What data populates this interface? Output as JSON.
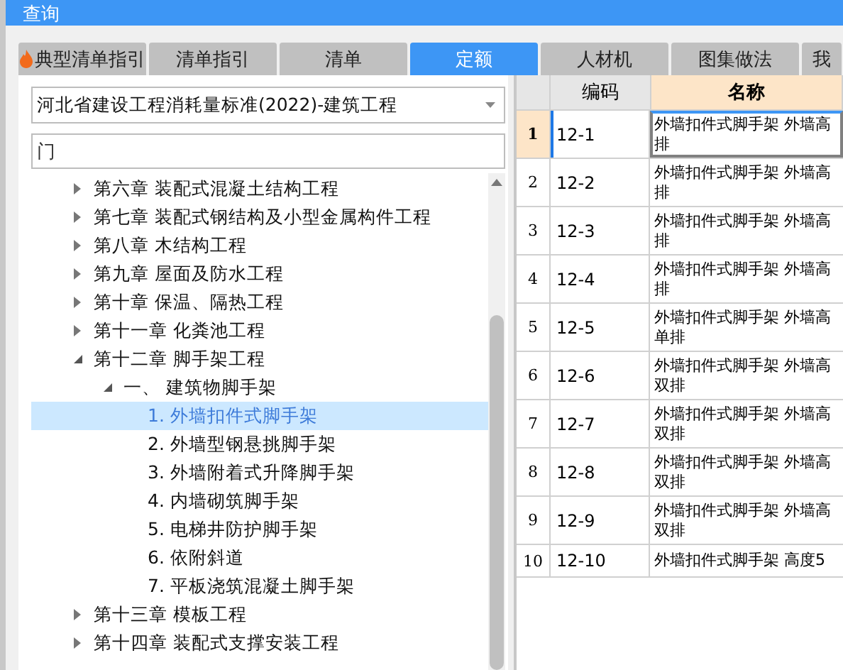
{
  "window": {
    "title": "查询"
  },
  "tabs": [
    {
      "label": "典型清单指引",
      "selected": false,
      "kind": "hot"
    },
    {
      "label": "清单指引",
      "selected": false,
      "kind": "plain"
    },
    {
      "label": "清单",
      "selected": false,
      "kind": "plain"
    },
    {
      "label": "定额",
      "selected": true,
      "kind": "plain"
    },
    {
      "label": "人材机",
      "selected": false,
      "kind": "plain"
    },
    {
      "label": "图集做法",
      "selected": false,
      "kind": "plain"
    },
    {
      "label": "我",
      "selected": false,
      "kind": "plain"
    }
  ],
  "library_select": {
    "value": "河北省建设工程消耗量标准(2022)-建筑工程"
  },
  "search": {
    "value": "门"
  },
  "tree": [
    {
      "label": "第六章 装配式混凝土结构工程",
      "expanded": false,
      "selected": false
    },
    {
      "label": "第七章 装配式钢结构及小型金属构件工程",
      "expanded": false,
      "selected": false
    },
    {
      "label": "第八章 木结构工程",
      "expanded": false,
      "selected": false
    },
    {
      "label": "第九章 屋面及防水工程",
      "expanded": false,
      "selected": false
    },
    {
      "label": "第十章 保温、隔热工程",
      "expanded": false,
      "selected": false
    },
    {
      "label": "第十一章 化粪池工程",
      "expanded": false,
      "selected": false
    },
    {
      "label": "第十二章 脚手架工程",
      "expanded": true,
      "selected": false,
      "children": [
        {
          "label": "一、 建筑物脚手架",
          "expanded": true,
          "selected": false,
          "children": [
            {
              "label": "1. 外墙扣件式脚手架",
              "selected": true
            },
            {
              "label": "2. 外墙型钢悬挑脚手架",
              "selected": false
            },
            {
              "label": "3. 外墙附着式升降脚手架",
              "selected": false
            },
            {
              "label": "4. 内墙砌筑脚手架",
              "selected": false
            },
            {
              "label": "5. 电梯井防护脚手架",
              "selected": false
            },
            {
              "label": "6. 依附斜道",
              "selected": false
            },
            {
              "label": "7. 平板浇筑混凝土脚手架",
              "selected": false
            }
          ]
        }
      ]
    },
    {
      "label": "第十三章 模板工程",
      "expanded": false,
      "selected": false
    },
    {
      "label": "第十四章 装配式支撑安装工程",
      "expanded": false,
      "selected": false
    }
  ],
  "table": {
    "columns": [
      "编码",
      "名称"
    ],
    "rows": [
      {
        "number": "1",
        "code": "12-1",
        "name": "外墙扣件式脚手架 外墙高",
        "name_2": "排",
        "selected": true
      },
      {
        "number": "2",
        "code": "12-2",
        "name": "外墙扣件式脚手架 外墙高",
        "name_2": "排",
        "selected": false
      },
      {
        "number": "3",
        "code": "12-3",
        "name": "外墙扣件式脚手架 外墙高",
        "name_2": "排",
        "selected": false
      },
      {
        "number": "4",
        "code": "12-4",
        "name": "外墙扣件式脚手架 外墙高",
        "name_2": "排",
        "selected": false
      },
      {
        "number": "5",
        "code": "12-5",
        "name": "外墙扣件式脚手架 外墙高",
        "name_2": "单排",
        "selected": false
      },
      {
        "number": "6",
        "code": "12-6",
        "name": "外墙扣件式脚手架 外墙高",
        "name_2": "双排",
        "selected": false
      },
      {
        "number": "7",
        "code": "12-7",
        "name": "外墙扣件式脚手架 外墙高",
        "name_2": "双排",
        "selected": false
      },
      {
        "number": "8",
        "code": "12-8",
        "name": "外墙扣件式脚手架 外墙高",
        "name_2": "双排",
        "selected": false
      },
      {
        "number": "9",
        "code": "12-9",
        "name": "外墙扣件式脚手架 外墙高",
        "name_2": "双排",
        "selected": false
      },
      {
        "number": "10",
        "code": "12-10",
        "name": "外墙扣件式脚手架 高度5",
        "selected": false
      }
    ]
  }
}
